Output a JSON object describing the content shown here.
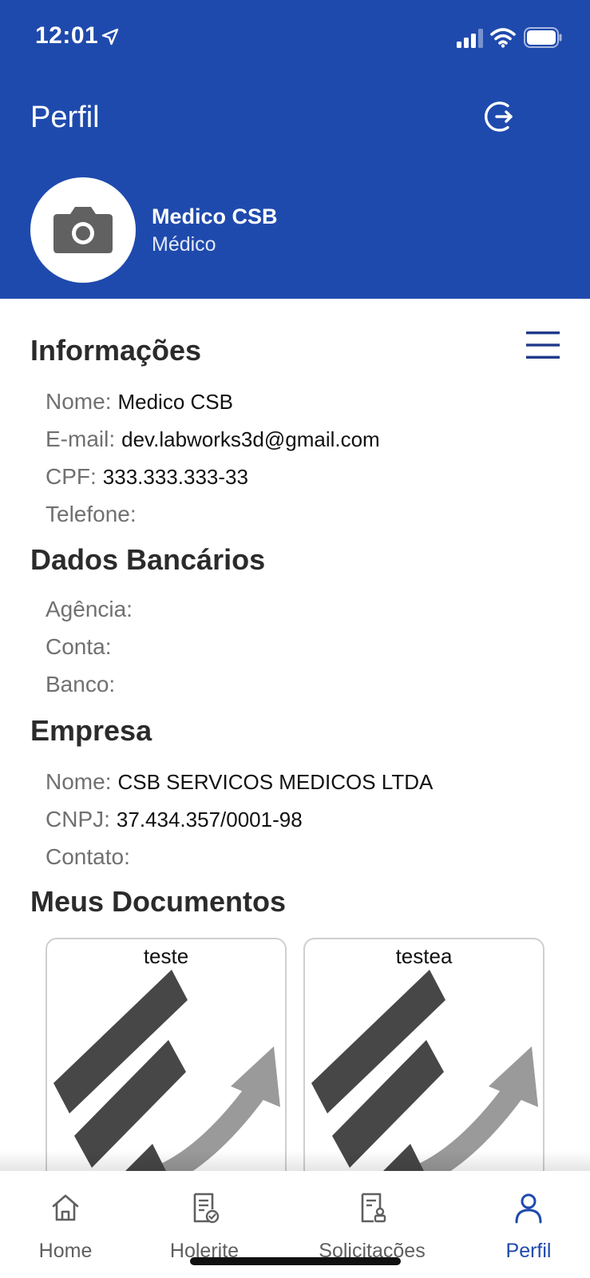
{
  "status_bar": {
    "time": "12:01"
  },
  "header": {
    "title": "Perfil",
    "user_name": "Medico CSB",
    "user_role": "Médico"
  },
  "informacoes": {
    "title": "Informações",
    "fields": [
      {
        "label": "Nome:",
        "value": "Medico CSB"
      },
      {
        "label": "E-mail:",
        "value": "dev.labworks3d@gmail.com"
      },
      {
        "label": "CPF:",
        "value": "333.333.333-33"
      },
      {
        "label": "Telefone:",
        "value": ""
      }
    ]
  },
  "dados_bancarios": {
    "title": "Dados Bancários",
    "fields": [
      {
        "label": "Agência:",
        "value": ""
      },
      {
        "label": "Conta:",
        "value": ""
      },
      {
        "label": "Banco:",
        "value": ""
      }
    ]
  },
  "empresa": {
    "title": "Empresa",
    "fields": [
      {
        "label": "Nome:",
        "value": "CSB SERVICOS MEDICOS LTDA"
      },
      {
        "label": "CNPJ:",
        "value": "37.434.357/0001-98"
      },
      {
        "label": "Contato:",
        "value": ""
      }
    ]
  },
  "documentos": {
    "title": "Meus Documentos",
    "items": [
      {
        "title": "teste"
      },
      {
        "title": "testea"
      }
    ]
  },
  "tabbar": {
    "tabs": [
      {
        "label": "Home",
        "icon": "home-icon"
      },
      {
        "label": "Holerite",
        "icon": "payslip-icon"
      },
      {
        "label": "Solicitações",
        "icon": "requests-icon"
      },
      {
        "label": "Perfil",
        "icon": "person-icon",
        "active": true
      }
    ]
  },
  "colors": {
    "primary": "#1f4aad",
    "label_gray": "#707070"
  }
}
